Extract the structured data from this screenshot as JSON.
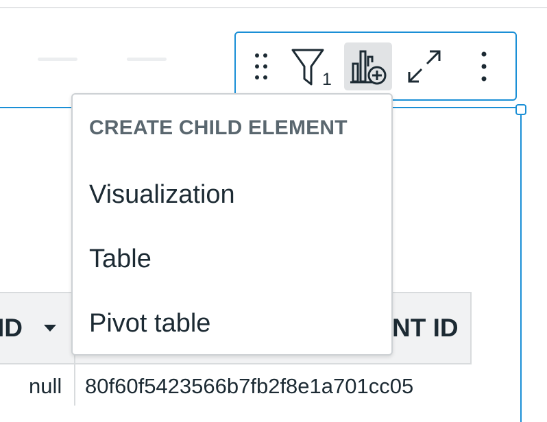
{
  "toolbar": {
    "filter_count": "1",
    "buttons": [
      {
        "icon": "drag-handle-icon"
      },
      {
        "icon": "filter-icon"
      },
      {
        "icon": "add-chart-icon"
      },
      {
        "icon": "expand-icon"
      },
      {
        "icon": "more-vertical-icon"
      }
    ]
  },
  "menu": {
    "heading": "CREATE CHILD ELEMENT",
    "items": [
      {
        "label": "Visualization"
      },
      {
        "label": "Table"
      },
      {
        "label": "Pivot table"
      }
    ]
  },
  "table": {
    "columns": [
      {
        "label": "ID"
      },
      {
        "label": "NT ID"
      }
    ],
    "rows": [
      {
        "col1": "null",
        "col2": "80f60f5423566b7fb2f8e1a701cc05"
      }
    ]
  },
  "colors": {
    "accent": "#1a8fd6",
    "text": "#1c2a33",
    "muted": "#5a676f",
    "header_bg": "#f1f2f3"
  }
}
